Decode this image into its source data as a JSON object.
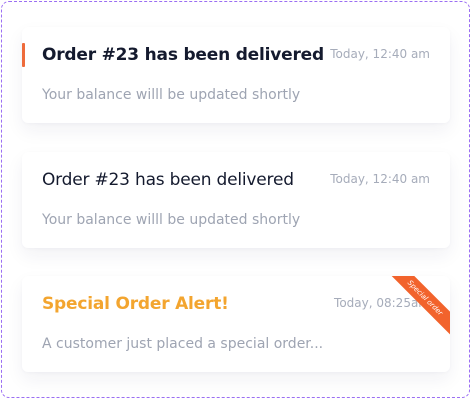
{
  "notifications": [
    {
      "title": "Order #23 has been delivered",
      "time": "Today, 12:40 am",
      "message": "Your balance willl be updated shortly"
    },
    {
      "title": "Order #23 has been delivered",
      "time": "Today, 12:40 am",
      "message": "Your balance willl be updated shortly"
    },
    {
      "title": "Special Order Alert!",
      "time": "Today, 08:25am",
      "message": "A customer just placed a special order...",
      "ribbon": "Special order"
    }
  ],
  "colors": {
    "frame_dash": "#9b6ef3",
    "unread_accent": "#ee6b3b",
    "special_title": "#f3a52f",
    "ribbon": "#f2632c"
  }
}
